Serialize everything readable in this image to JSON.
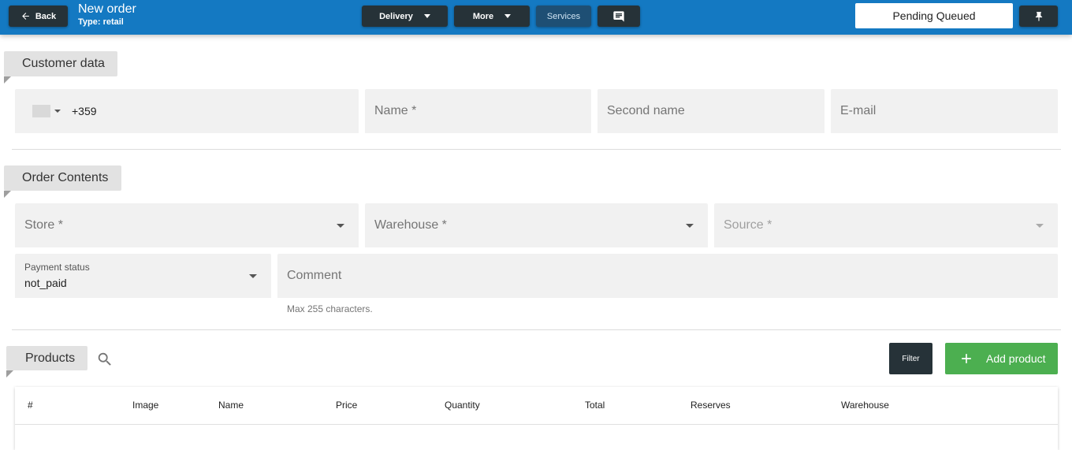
{
  "header": {
    "back_label": "Back",
    "title": "New order",
    "subtitle": "Type: retail",
    "delivery_label": "Delivery",
    "more_label": "More",
    "services_label": "Services",
    "status_value": "Pending Queued"
  },
  "customer": {
    "section_title": "Customer data",
    "phone_code": "+359",
    "name_placeholder": "Name *",
    "second_name_placeholder": "Second name",
    "email_placeholder": "E-mail"
  },
  "order": {
    "section_title": "Order Contents",
    "store_placeholder": "Store *",
    "warehouse_placeholder": "Warehouse *",
    "source_placeholder": "Source *",
    "payment_status_label": "Payment status",
    "payment_status_value": "not_paid",
    "comment_placeholder": "Comment",
    "comment_hint": "Max 255 characters."
  },
  "products": {
    "section_title": "Products",
    "filter_label": "Filter",
    "add_label": "Add product",
    "columns": [
      "#",
      "Image",
      "Name",
      "Price",
      "Quantity",
      "Total",
      "Reserves",
      "Warehouse"
    ]
  },
  "colors": {
    "topbar": "#1479c2",
    "dark_button": "#263238",
    "add_button": "#4caf50"
  }
}
